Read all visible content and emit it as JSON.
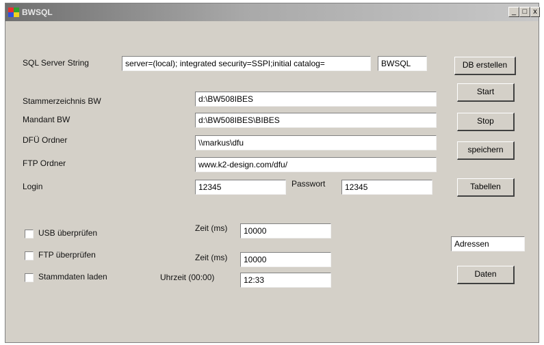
{
  "window": {
    "title": "BWSQL",
    "controls": {
      "minimize": "_",
      "maximize": "□",
      "close": "x"
    }
  },
  "sql_server": {
    "label": "SQL Server String",
    "connection_value": "server=(local); integrated security=SSPI;initial catalog=",
    "db_name_value": "BWSQL"
  },
  "fields": [
    {
      "label": "Stammerzeichnis BW",
      "value": "d:\\BW508IBES"
    },
    {
      "label": "Mandant BW",
      "value": "d:\\BW508IBES\\BIBES"
    },
    {
      "label": "DFÜ Ordner",
      "value": "\\\\markus\\dfu"
    },
    {
      "label": "FTP Ordner",
      "value": "www.k2-design.com/dfu/"
    }
  ],
  "login": {
    "label": "Login",
    "value": "12345",
    "password_label": "Passwort",
    "password_value": "12345"
  },
  "options": {
    "usb": {
      "label": "USB überprüfen",
      "checked": false,
      "time_label": "Zeit (ms)",
      "time_value": "10000"
    },
    "ftp": {
      "label": "FTP überprüfen",
      "checked": false,
      "time_label": "Zeit (ms)",
      "time_value": "10000"
    },
    "stamm": {
      "label": "Stammdaten laden",
      "checked": false,
      "time_label": "Uhrzeit (00:00)",
      "time_value": "12:33"
    }
  },
  "buttons": {
    "db_erstellen": "DB erstellen",
    "start": "Start",
    "stop": "Stop",
    "speichern": "speichern",
    "tabellen": "Tabellen",
    "daten": "Daten"
  },
  "adressen_value": "Adressen"
}
